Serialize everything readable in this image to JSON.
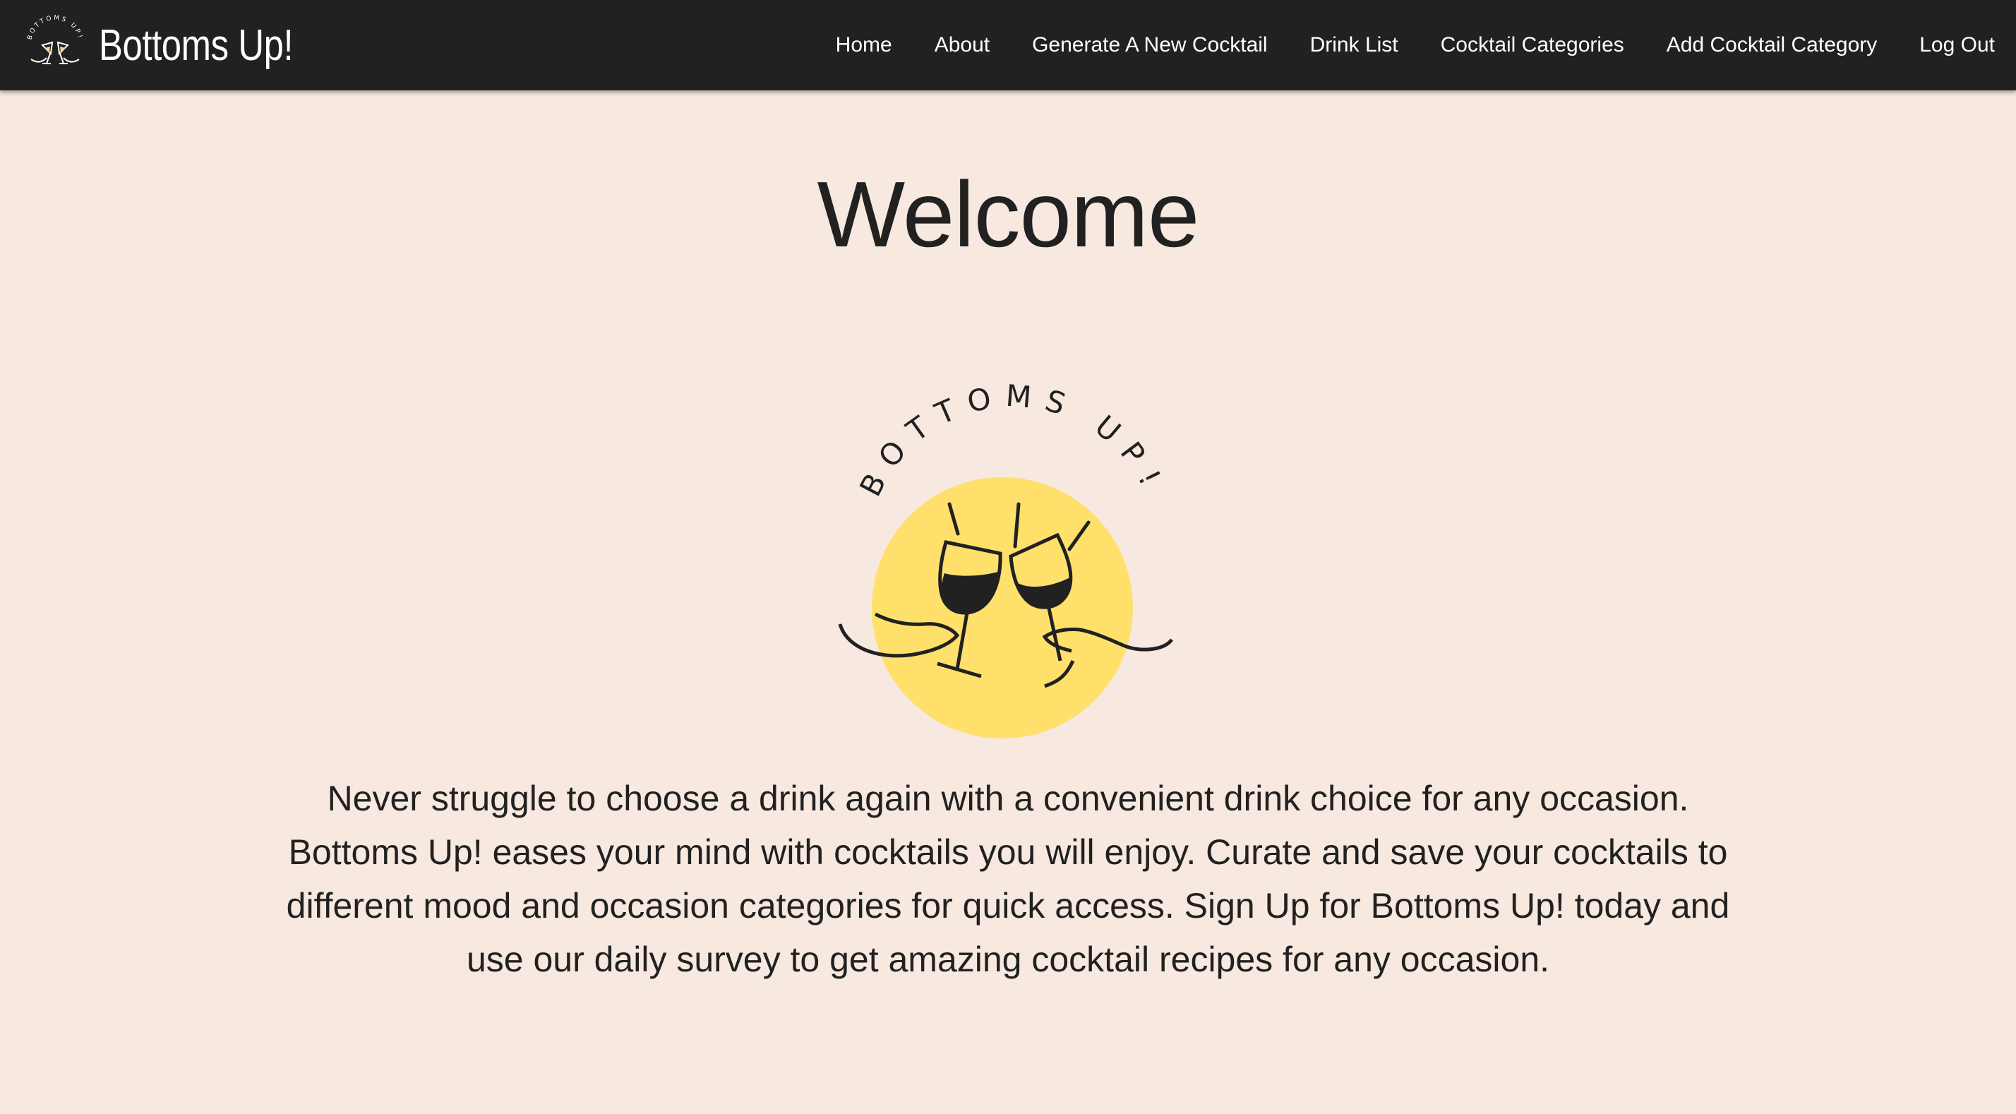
{
  "navbar": {
    "brand_title": "Bottoms Up!",
    "brand_logo_icon": "clinking-glasses-logo-icon",
    "links": [
      {
        "label": "Home"
      },
      {
        "label": "About"
      },
      {
        "label": "Generate A New Cocktail"
      },
      {
        "label": "Drink List"
      },
      {
        "label": "Cocktail Categories"
      },
      {
        "label": "Add Cocktail Category"
      },
      {
        "label": "Log Out"
      }
    ]
  },
  "main": {
    "heading": "Welcome",
    "logo": {
      "icon": "clinking-wine-glasses-logo",
      "arc_text": "BOTTOMS UP!"
    },
    "intro": "Never struggle to choose a drink again with a convenient drink choice for any occasion. Bottoms Up! eases your mind with cocktails you will enjoy. Curate and save your cocktails to different mood and occasion categories for quick access. Sign Up for Bottoms Up! today and use our daily survey to get amazing cocktail recipes for any occasion."
  },
  "colors": {
    "navbar_bg": "#212121",
    "page_bg": "#f7e9df",
    "logo_circle": "#ffe06b",
    "text": "#212121"
  }
}
